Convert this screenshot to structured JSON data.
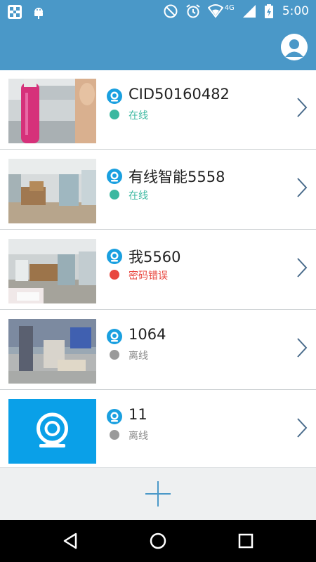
{
  "status_bar": {
    "time": "5:00",
    "network_label": "4G",
    "icons": [
      "app-grid-icon",
      "android-debug-icon",
      "do-not-disturb-icon",
      "alarm-icon",
      "wifi-icon",
      "cellular-signal-icon",
      "battery-icon"
    ]
  },
  "app_bar": {
    "avatar_icon": "user-avatar-icon"
  },
  "devices": [
    {
      "name": "CID50160482",
      "status": "在线",
      "status_kind": "online",
      "status_color": "#3bb8a0",
      "thumbnail": "camera-snapshot"
    },
    {
      "name": "有线智能5558",
      "status": "在线",
      "status_kind": "online",
      "status_color": "#3bb8a0",
      "thumbnail": "camera-snapshot"
    },
    {
      "name": "我5560",
      "status": "密码错误",
      "status_kind": "password-error",
      "status_color": "#e8463e",
      "thumbnail": "camera-snapshot"
    },
    {
      "name": "1064",
      "status": "离线",
      "status_kind": "offline",
      "status_color": "#9a9a9a",
      "thumbnail": "camera-snapshot"
    },
    {
      "name": "11",
      "status": "离线",
      "status_kind": "offline",
      "status_color": "#9a9a9a",
      "thumbnail": "camera-placeholder"
    }
  ],
  "add_button": {
    "icon": "plus-icon"
  },
  "nav_bar": {
    "icons": [
      "back-icon",
      "home-icon",
      "recents-icon"
    ]
  },
  "colors": {
    "header": "#4a98c8",
    "online": "#3bb8a0",
    "error": "#e8463e",
    "offline": "#9a9a9a",
    "placeholder_bg": "#0aa0e8",
    "accent": "#4a98c8"
  }
}
